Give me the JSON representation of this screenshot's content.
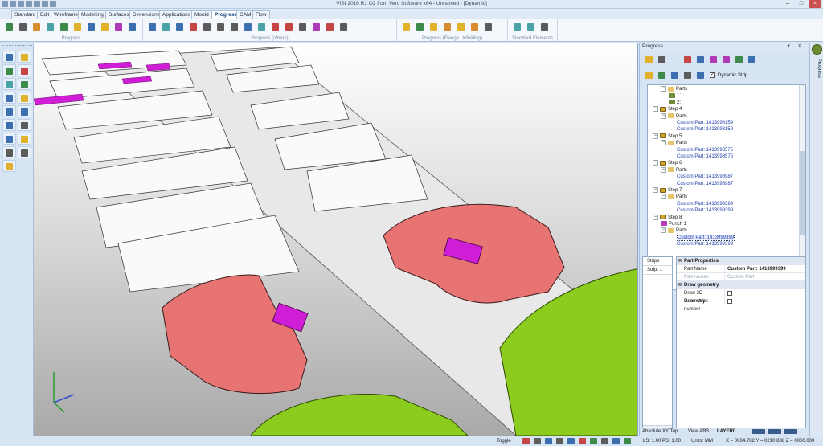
{
  "window": {
    "title": "VISI 2016 R1 Q2 from Vero Software x64 - Unnamed - [Dynamic]",
    "controls": [
      "–",
      "□",
      "×"
    ]
  },
  "ribbon": {
    "tabs": [
      "Standard",
      "Edit",
      "Wireframe",
      "Modelling",
      "Surfaces",
      "Dimensions",
      "Applications",
      "Mould",
      "Progress",
      "CAM",
      "Flow"
    ],
    "active_tab": "Progress",
    "groups": [
      "Progress",
      "Progress (others)",
      "Progress (Flange Unfolding)",
      "Standard Elements"
    ]
  },
  "progress_panel": {
    "title": "Progress",
    "dynamic_strip_label": "Dynamic Strip",
    "dynamic_strip_checked": true,
    "tree": [
      {
        "kind": "parts",
        "label": "Parts",
        "indent": 1
      },
      {
        "kind": "part",
        "label": "1:",
        "indent": 2
      },
      {
        "kind": "part",
        "label": "2:",
        "indent": 2
      },
      {
        "kind": "step",
        "label": "Step 4",
        "indent": 0
      },
      {
        "kind": "parts",
        "label": "Parts",
        "indent": 1
      },
      {
        "kind": "custom",
        "label": "Custom Part: 1413998159",
        "indent": 2
      },
      {
        "kind": "custom",
        "label": "Custom Part: 1413998159",
        "indent": 2
      },
      {
        "kind": "step",
        "label": "Step 5",
        "indent": 0
      },
      {
        "kind": "parts",
        "label": "Parts",
        "indent": 1
      },
      {
        "kind": "custom",
        "label": "Custom Part: 1413998575",
        "indent": 2
      },
      {
        "kind": "custom",
        "label": "Custom Part: 1413998575",
        "indent": 2
      },
      {
        "kind": "step",
        "label": "Step 6",
        "indent": 0
      },
      {
        "kind": "parts",
        "label": "Parts",
        "indent": 1
      },
      {
        "kind": "custom",
        "label": "Custom Part: 1413998987",
        "indent": 2
      },
      {
        "kind": "custom",
        "label": "Custom Part: 1413998987",
        "indent": 2
      },
      {
        "kind": "step",
        "label": "Step 7",
        "indent": 0
      },
      {
        "kind": "parts",
        "label": "Parts",
        "indent": 1
      },
      {
        "kind": "custom",
        "label": "Custom Part: 1413999399",
        "indent": 2
      },
      {
        "kind": "custom",
        "label": "Custom Part: 1413999399",
        "indent": 2
      },
      {
        "kind": "step",
        "label": "Step 8",
        "indent": 0
      },
      {
        "kind": "punch",
        "label": "Punch 1",
        "indent": 1
      },
      {
        "kind": "parts",
        "label": "Parts",
        "indent": 1
      },
      {
        "kind": "custom sel",
        "label": "Custom Part: 1413999399",
        "indent": 2
      },
      {
        "kind": "custom",
        "label": "Custom Part: 1413999399",
        "indent": 2
      }
    ],
    "strips": [
      "Strips",
      "Strip. 1"
    ],
    "properties": {
      "section1": "Part Properties",
      "part_name_key": "Part Name",
      "part_name_value": "Custom Part: 1413999399",
      "part_names_key": "Part names",
      "part_names_value": "Custom Part",
      "section2": "Draw geometry",
      "draw2d_key": "Draw 2D Geometry",
      "drawsteps_key": "Draw steps number"
    }
  },
  "side_tab": "Progress",
  "view_info": {
    "plane": "Absolute XY Top",
    "view": "View ABS",
    "layer": "LAYER0"
  },
  "status": {
    "toggle": "Toggle",
    "ls_ps": "LS: 1.00 PS: 1.00",
    "units": "Units: MM",
    "coords": "X = 0064.782 Y = 0210.888 Z = 0000.000"
  },
  "colors": {
    "accent_active_tab": "#0d3d7a",
    "part_red": "#e87373",
    "part_green": "#8ccc1e",
    "punch_magenta": "#d01ed6"
  }
}
